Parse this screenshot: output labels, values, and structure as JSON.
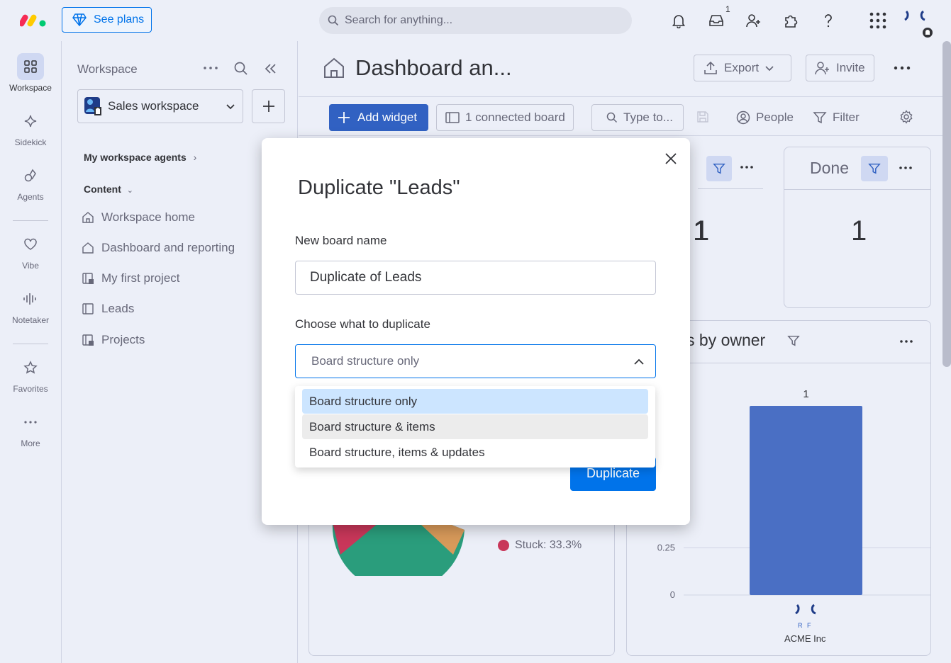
{
  "topbar": {
    "see_plans": "See plans",
    "search_placeholder": "Search for anything...",
    "inbox_badge": "1"
  },
  "rail": {
    "items": [
      {
        "label": "Workspace",
        "icon": "grid-icon"
      },
      {
        "label": "Sidekick",
        "icon": "sparkle-icon"
      },
      {
        "label": "Agents",
        "icon": "agents-icon"
      },
      {
        "label": "Vibe",
        "icon": "heart-icon"
      },
      {
        "label": "Notetaker",
        "icon": "waveform-icon"
      },
      {
        "label": "Favorites",
        "icon": "star-icon"
      },
      {
        "label": "More",
        "icon": "more-icon"
      }
    ]
  },
  "sidebar": {
    "title": "Workspace",
    "workspace_name": "Sales workspace",
    "agents_section": "My workspace agents",
    "content_section": "Content",
    "items": [
      {
        "label": "Workspace home"
      },
      {
        "label": "Dashboard and reporting"
      },
      {
        "label": "My first project"
      },
      {
        "label": "Leads"
      },
      {
        "label": "Projects"
      }
    ]
  },
  "main": {
    "title": "Dashboard an...",
    "export": "Export",
    "invite": "Invite",
    "add_widget": "Add widget",
    "connected_board": "1 connected board",
    "type_to": "Type to...",
    "people": "People",
    "filter": "Filter",
    "card_done_title": "Done",
    "card_stuck_value": "1",
    "card_done_value": "1",
    "chart_title_fragment": "s by owner",
    "legend_stuck": "Stuck: 33.3%",
    "owner_name": "ACME Inc",
    "owner_initials": "R F"
  },
  "chart_data": {
    "type": "bar",
    "categories": [
      "ACME Inc"
    ],
    "values": [
      1
    ],
    "data_labels": [
      "1"
    ],
    "y_ticks": [
      "0",
      "0.25"
    ],
    "ylim": [
      0,
      1
    ],
    "bar_color": "#4a6fc4"
  },
  "modal": {
    "title": "Duplicate \"Leads\"",
    "name_label": "New board name",
    "name_value": "Duplicate of Leads",
    "choose_label": "Choose what to duplicate",
    "selected_value": "Board structure only",
    "options": [
      {
        "label": "Board structure only",
        "state": "selected"
      },
      {
        "label": "Board structure & items",
        "state": "hover"
      },
      {
        "label": "Board structure, items & updates",
        "state": "normal"
      }
    ],
    "duplicate_button": "Duplicate"
  },
  "colors": {
    "primary": "#0073ea",
    "selected_option": "#cce5ff",
    "pie_green": "#2a9d7c",
    "stuck_red": "#c9375a"
  }
}
